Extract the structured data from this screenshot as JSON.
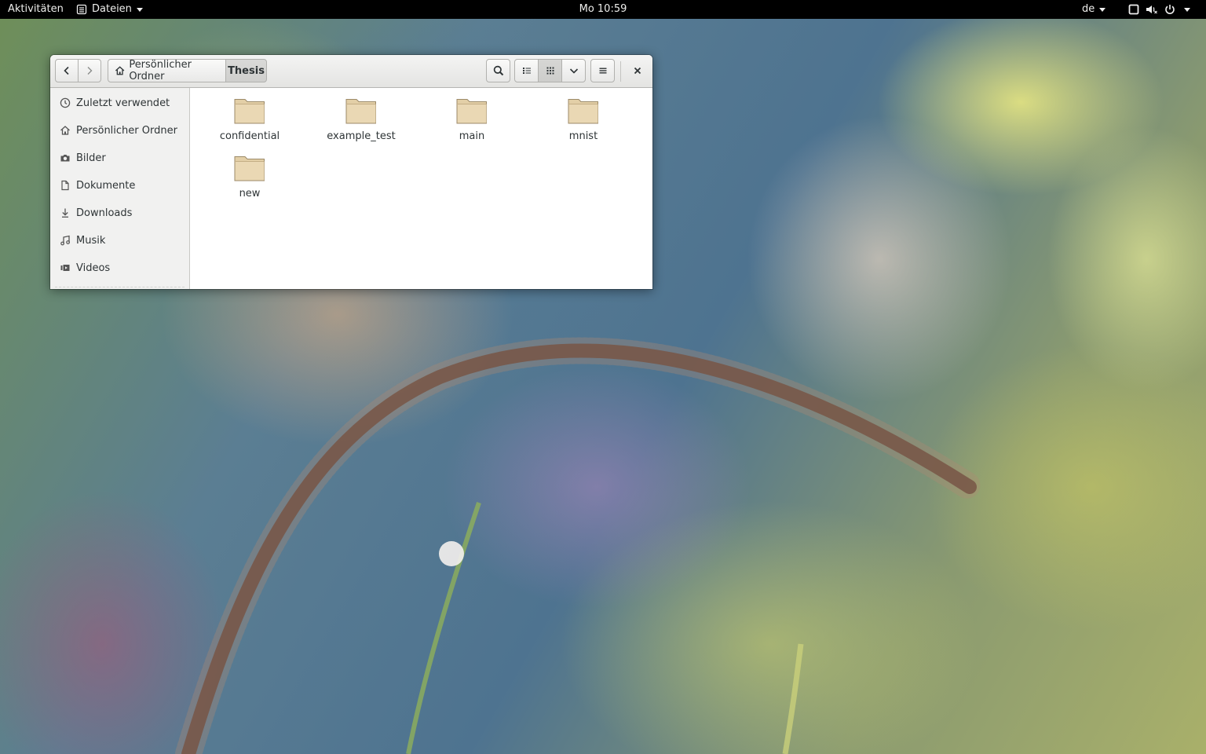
{
  "topbar": {
    "activities": "Aktivitäten",
    "app_menu": "Dateien",
    "clock": "Mo 10:59",
    "language": "de"
  },
  "window": {
    "path": {
      "home": "Persönlicher Ordner",
      "current": "Thesis"
    },
    "view_mode": "grid",
    "sidebar": {
      "items": [
        {
          "label": "Zuletzt verwendet",
          "icon": "clock-icon"
        },
        {
          "label": "Persönlicher Ordner",
          "icon": "home-icon"
        },
        {
          "label": "Bilder",
          "icon": "camera-icon"
        },
        {
          "label": "Dokumente",
          "icon": "document-icon"
        },
        {
          "label": "Downloads",
          "icon": "download-icon"
        },
        {
          "label": "Musik",
          "icon": "music-icon"
        },
        {
          "label": "Videos",
          "icon": "video-icon"
        }
      ]
    },
    "folders": [
      {
        "name": "confidential"
      },
      {
        "name": "example_test"
      },
      {
        "name": "main"
      },
      {
        "name": "mnist"
      },
      {
        "name": "new"
      }
    ]
  },
  "colors": {
    "topbar_bg": "#000000",
    "folder_fill": "#e3cfa7",
    "folder_stroke": "#9c8a68",
    "window_bg": "#ffffff",
    "sidebar_bg": "#f1f1f0"
  }
}
